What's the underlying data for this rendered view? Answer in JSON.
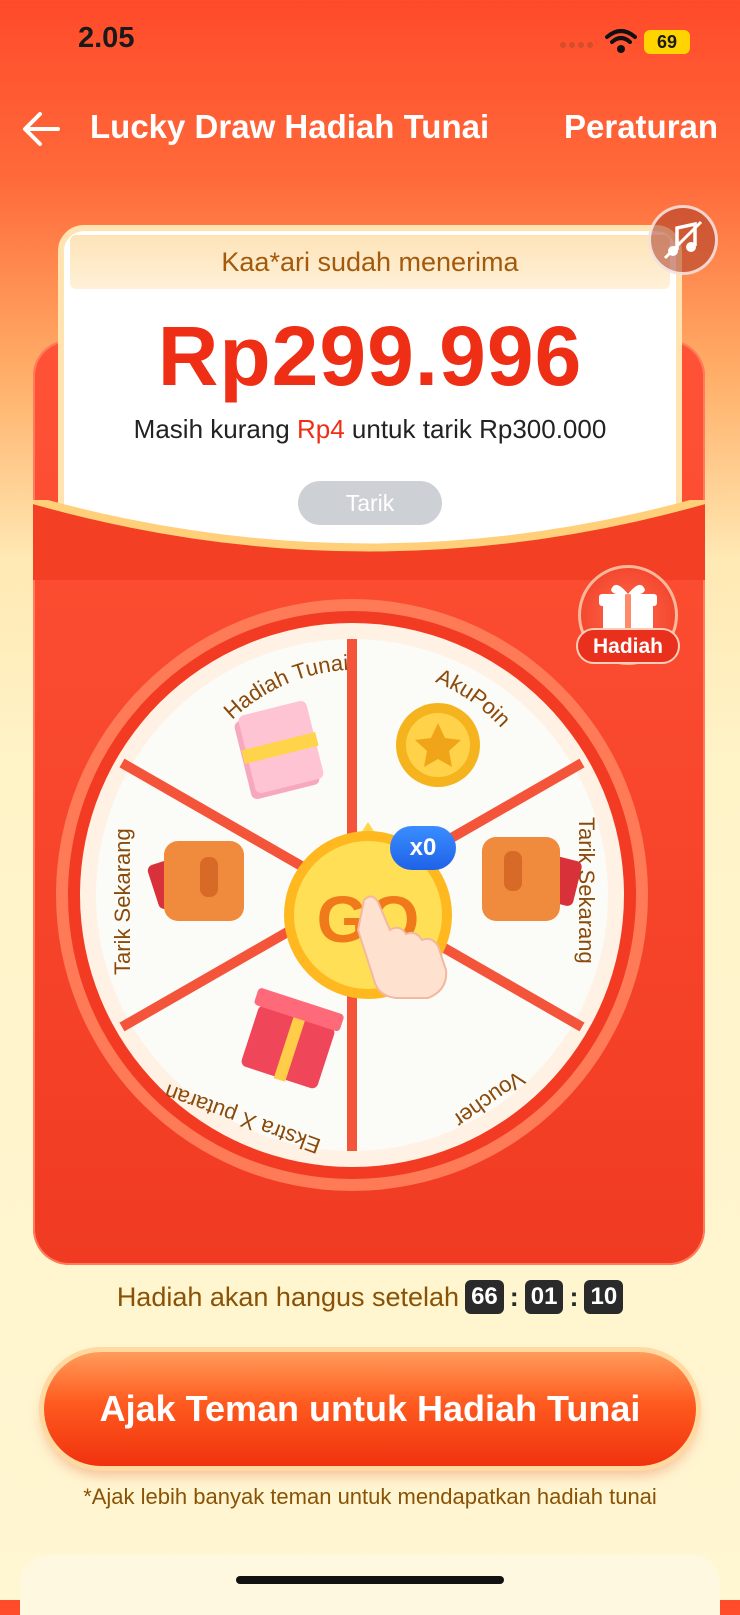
{
  "status": {
    "time": "2.05",
    "battery": "69"
  },
  "nav": {
    "title": "Lucky Draw Hadiah Tunai",
    "rules_label": "Peraturan"
  },
  "card": {
    "received_text": "Kaa*ari sudah menerima",
    "amount": "Rp299.996",
    "hint_prefix": "Masih kurang ",
    "hint_amount": "Rp4",
    "hint_suffix": " untuk tarik Rp300.000",
    "withdraw_label": "Tarik"
  },
  "gift_label": "Hadiah",
  "wheel": {
    "segments": [
      "AkuPoin",
      "Tarik Sekarang",
      "Voucher",
      "Ekstra X putaran",
      "Tarik Sekarang",
      "Hadiah Tunai"
    ],
    "go_label": "GO",
    "spins_badge": "x0"
  },
  "timer": {
    "label": "Hadiah akan hangus setelah",
    "hours": "66",
    "minutes": "01",
    "seconds": "10"
  },
  "cta_label": "Ajak Teman untuk Hadiah Tunai",
  "footnote": "*Ajak lebih banyak teman untuk mendapatkan hadiah tunai",
  "colors": {
    "primary_red": "#ee2e15",
    "brand_orange": "#ff5a1f",
    "timer_text": "#8a5206"
  }
}
